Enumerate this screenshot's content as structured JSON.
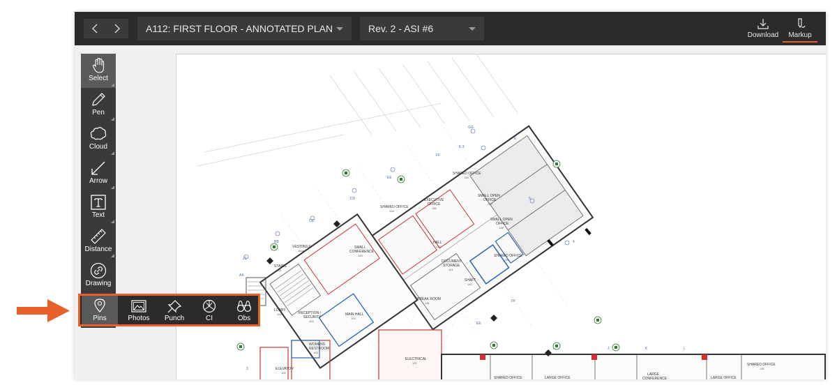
{
  "topbar": {
    "sheet_title": "A112: FIRST FLOOR - ANNOTATED PLAN",
    "revision": "Rev. 2 - ASI #6",
    "download_label": "Download",
    "markup_label": "Markup"
  },
  "toolbar": {
    "tools": [
      {
        "label": "Select",
        "icon": "hand-icon"
      },
      {
        "label": "Pen",
        "icon": "pen-icon"
      },
      {
        "label": "Cloud",
        "icon": "cloud-icon"
      },
      {
        "label": "Arrow",
        "icon": "arrow-icon"
      },
      {
        "label": "Text",
        "icon": "text-icon"
      },
      {
        "label": "Distance",
        "icon": "ruler-icon"
      },
      {
        "label": "Drawing",
        "icon": "link-icon"
      }
    ]
  },
  "pins": {
    "label": "Pins",
    "items": [
      {
        "label": "Photos",
        "icon": "photo-icon"
      },
      {
        "label": "Punch",
        "icon": "pushpin-icon"
      },
      {
        "label": "CI",
        "icon": "coordination-issue-icon"
      },
      {
        "label": "Obs",
        "icon": "binoculars-icon"
      }
    ]
  },
  "plan": {
    "rooms": [
      {
        "name": "SHARED OFFICE",
        "num": "136"
      },
      {
        "name": "SMALL OPEN OFFICE",
        "num": "137"
      },
      {
        "name": "SMALL OPEN OFFICE",
        "num": "138"
      },
      {
        "name": "SHARED OFFICE",
        "num": "139"
      },
      {
        "name": "EXECUTIVE OFFICE",
        "num": "135"
      },
      {
        "name": "SHARED OFFICE",
        "num": "134"
      },
      {
        "name": "SMALL CONFERENCE",
        "num": "133"
      },
      {
        "name": "HALL",
        "num": "132"
      },
      {
        "name": "DOCUMENT STORAGE",
        "num": "141"
      },
      {
        "name": "SHAFT",
        "num": "140"
      },
      {
        "name": "BREAK ROOM",
        "num": "131"
      },
      {
        "name": "VESTIBULE",
        "num": "100A"
      },
      {
        "name": "STAIRS",
        "num": "101"
      },
      {
        "name": "LOBBY",
        "num": "100"
      },
      {
        "name": "RECEPTION / SECURITY",
        "num": "102"
      },
      {
        "name": "MAIN HALL",
        "num": "104"
      },
      {
        "name": "WOMENS RESTROOM",
        "num": "103"
      },
      {
        "name": "ELEVATOR",
        "num": "105"
      },
      {
        "name": "ELECTRICAL",
        "num": "121"
      },
      {
        "name": "SHARED OFFICE",
        "num": ""
      },
      {
        "name": "LARGE OFFICE",
        "num": ""
      },
      {
        "name": "LARGE CONFERENCE",
        "num": ""
      },
      {
        "name": "LARGE OFFICE",
        "num": ""
      },
      {
        "name": "SHARED OFFICE",
        "num": "130"
      }
    ],
    "grid_labels": [
      "GG",
      "FF",
      "EE",
      "DD",
      "CC",
      "BB",
      "Z1",
      "AA",
      "E.3",
      "H",
      "J",
      "K",
      "L",
      "5",
      "4",
      "3",
      "2"
    ]
  },
  "colors": {
    "accent": "#e8602c",
    "topbar_bg": "#2b2b2b",
    "toolbar_bg": "#3a3a3a"
  }
}
